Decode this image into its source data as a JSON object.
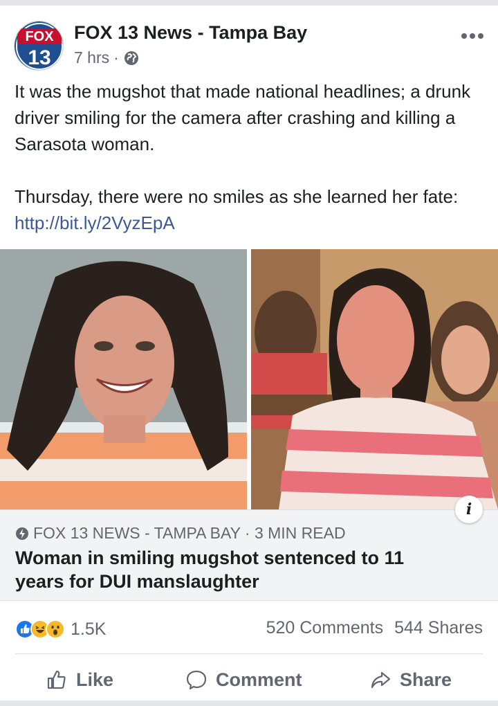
{
  "post": {
    "page_name": "FOX 13 News - Tampa Bay",
    "time": "7 hrs",
    "separator": "·",
    "avatar_brand": "FOX",
    "avatar_number": "13",
    "text_line1": "It was the mugshot that made national headlines; a drunk driver smiling for the camera after crashing and killing a Sarasota woman.",
    "text_line2_prefix": "Thursday, there were no smiles as she learned her fate: ",
    "link": "http://bit.ly/2VyzEpA"
  },
  "preview": {
    "source": "FOX 13 NEWS - TAMPA BAY · 3 MIN READ",
    "headline": "Woman in smiling mugshot sentenced to 11 years for DUI manslaughter",
    "info_label": "i"
  },
  "engagement": {
    "reaction_icons": [
      "like-reaction",
      "haha-reaction",
      "wow-reaction"
    ],
    "reaction_count": "1.5K",
    "comments": "520 Comments",
    "shares": "544 Shares"
  },
  "actions": {
    "like": "Like",
    "comment": "Comment",
    "share": "Share"
  },
  "colors": {
    "link": "#3b5998",
    "fox_blue": "#1d4f91",
    "fox_red": "#c8102e",
    "like_blue": "#1877f2",
    "reaction_yellow": "#f7b928",
    "secondary_text": "#606770"
  }
}
